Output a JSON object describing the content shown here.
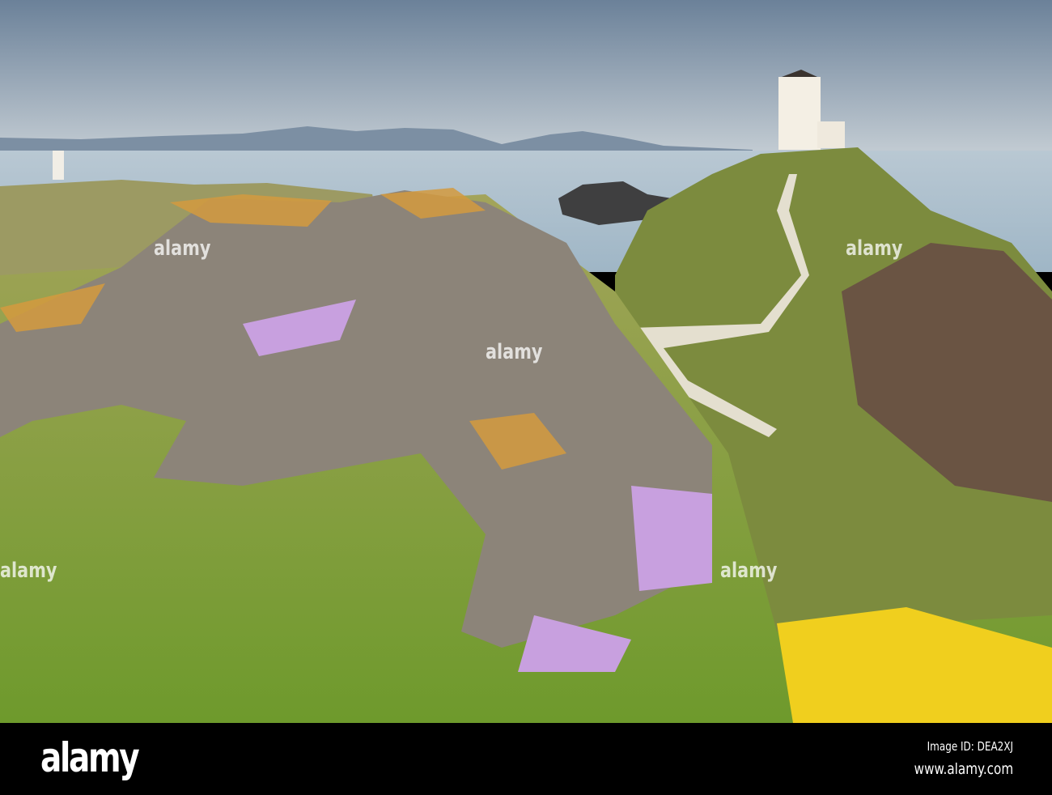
{
  "watermark": "alamy",
  "footer": {
    "logo": "alamy",
    "image_id": "Image ID: DEA2XJ",
    "url": "www.alamy.com"
  },
  "colors": {
    "sky_top": "#6b8199",
    "sky_bottom": "#b8c4cf",
    "sea": "#a9bfcf",
    "grass": "#7fa83c",
    "rock": "#8a8177",
    "lichen": "#d99a3a",
    "thrift": "#c99be0",
    "gorse": "#f2d21a"
  }
}
